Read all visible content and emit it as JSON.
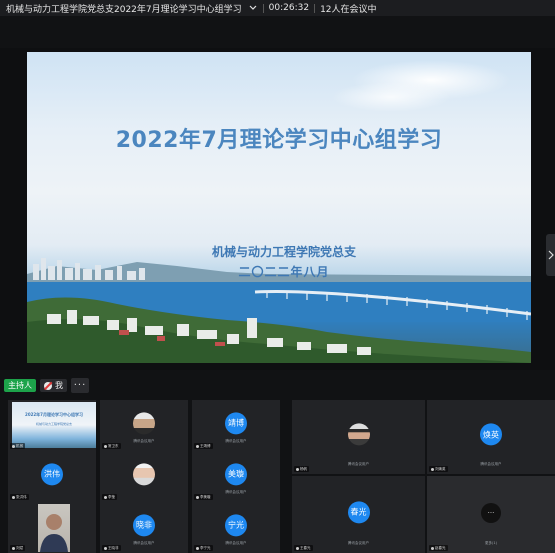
{
  "meeting": {
    "title": "机械与动力工程学院党总支2022年7月理论学习中心组学习",
    "timer": "00:26:32",
    "participants": "12人在会议中"
  },
  "slide": {
    "title": "2022年7月理论学习中心组学习",
    "org": "机械与动力工程学院党总支",
    "date": "二〇二二年八月"
  },
  "host_bar": {
    "host_label": "主持人",
    "me_label": "我",
    "more": "···"
  },
  "grid_left": [
    {
      "type": "screen",
      "thumb_title": "2022年7月理论学习中心组学习",
      "thumb_sub": "机械与动力工程学院党总支",
      "tag": "机械"
    },
    {
      "type": "photo",
      "sub": "腾讯会议用户",
      "tag": "常卫东"
    },
    {
      "type": "avatar",
      "avatar": "靖博",
      "sub": "腾讯会议用户",
      "tag": "王靖博"
    },
    {
      "type": "avatar",
      "avatar": "洪伟",
      "sub": "",
      "tag": "张洪伟"
    },
    {
      "type": "photo",
      "sub": "",
      "tag": "李莹"
    },
    {
      "type": "avatar",
      "avatar": "美璇",
      "sub": "腾讯会议用户",
      "tag": "李美璇"
    },
    {
      "type": "camera",
      "sub": "",
      "tag": "刘斌"
    },
    {
      "type": "avatar",
      "avatar": "晓非",
      "sub": "腾讯会议用户",
      "tag": "王晓非"
    },
    {
      "type": "avatar",
      "avatar": "宁光",
      "sub": "腾讯会议用户",
      "tag": "李宁光"
    }
  ],
  "grid_right": [
    {
      "type": "photo",
      "sub": "腾讯会议用户",
      "tag": "杨帆"
    },
    {
      "type": "avatar",
      "avatar": "焕英",
      "sub": "腾讯会议用户",
      "tag": "刘焕英"
    },
    {
      "type": "avatar",
      "avatar": "春光",
      "sub": "腾讯会议用户",
      "tag": "王春光"
    },
    {
      "type": "more",
      "avatar": "···",
      "sub": "更多(1)",
      "tag": "赵春光"
    }
  ],
  "colors": {
    "host_green": "#1da34a",
    "avatar_blue": "#1e88f0",
    "slide_title": "#4b86bf"
  }
}
